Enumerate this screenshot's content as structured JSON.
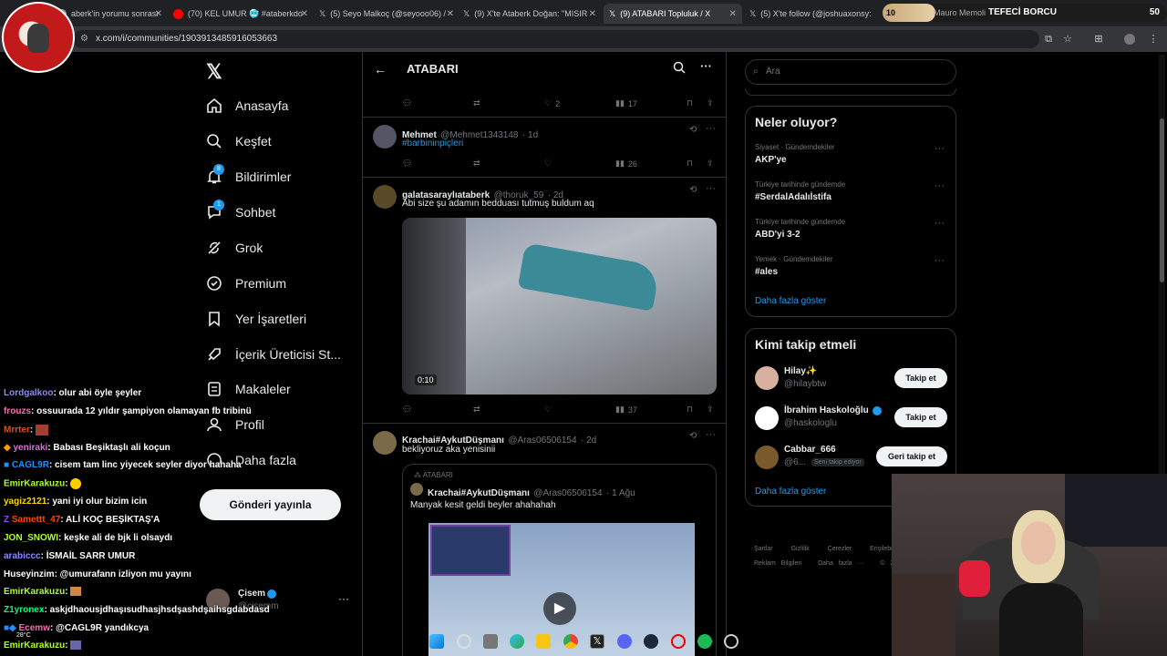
{
  "browser": {
    "tabs": [
      {
        "label": "aberk'in yorumu sonrası",
        "color": "#888"
      },
      {
        "label": "(70) KEL UMUR 🥶 #ataberkdo",
        "color": "#ff0000"
      },
      {
        "label": "(5) Seyo Malkoç (@seyooo06) /",
        "color": "#fff"
      },
      {
        "label": "(9) X'te Ataberk Doğan: \"MISIR",
        "color": "#fff"
      },
      {
        "label": "(9) ATABARI Topluluk / X",
        "color": "#fff"
      },
      {
        "label": "(5) X'te follow (@joshuaxonsy:",
        "color": "#fff"
      }
    ],
    "url": "x.com/i/communities/1903913485916053663"
  },
  "overlay": {
    "alert_count": "10",
    "alert_name": "Mauro Memoli",
    "alert_title": "TEFECİ BORCU",
    "alert_value": "50"
  },
  "nav": {
    "items": [
      {
        "label": "Anasayfa"
      },
      {
        "label": "Keşfet"
      },
      {
        "label": "Bildirimler"
      },
      {
        "label": "Sohbet"
      },
      {
        "label": "Grok"
      },
      {
        "label": "Premium"
      },
      {
        "label": "Yer İşaretleri"
      },
      {
        "label": "İçerik Üreticisi St..."
      },
      {
        "label": "Makaleler"
      },
      {
        "label": "Profil"
      },
      {
        "label": "Daha fazla"
      }
    ],
    "post_button": "Gönderi yayınla",
    "account_name": "Çisem",
    "account_handle": "@cisemm",
    "notif_badge": "8",
    "chat_badge": "1"
  },
  "feed": {
    "title": "ATABARI",
    "post1": {
      "likes": "2",
      "views": "17"
    },
    "post2": {
      "name": "Mehmet",
      "handle": "@Mehmet1343148",
      "time": "· 1d",
      "text": "#barbininpiçleri",
      "views": "26"
    },
    "post3": {
      "name": "galatasaraylıataberk",
      "handle": "@thoruk_59",
      "time": "· 2d",
      "text": "Abi size şu adamın bedduası tutmuş buldum aq",
      "duration": "0:10",
      "views": "37"
    },
    "post4": {
      "name": "Krachai#AykutDüşmanı",
      "handle": "@Aras06506154",
      "time": "· 2d",
      "text": "bekliyoruz aka yenisinii",
      "quote_community": "ATABARI",
      "quote_name": "Krachai#AykutDüşmanı",
      "quote_handle": "@Aras06506154",
      "quote_time": "· 1 Ağu",
      "quote_text": "Manyak kesit geldi beyler ahahahah"
    }
  },
  "right": {
    "search_placeholder": "Ara",
    "trends_title": "Neler oluyor?",
    "trends": [
      {
        "context": "Siyaset · Gündemdekiler",
        "name": "AKP'ye"
      },
      {
        "context": "Türkiye tarihinde gündemde",
        "name": "#SerdalAdalıİstifa"
      },
      {
        "context": "Türkiye tarihinde gündemde",
        "name": "ABD'yi 3-2"
      },
      {
        "context": "Yemek · Gündemdekiler",
        "name": "#ales"
      }
    ],
    "trends_more": "Daha fazla göster",
    "who_title": "Kimi takip etmeli",
    "who": [
      {
        "name": "Hilay✨",
        "handle": "@hilaybtw",
        "button": "Takip et"
      },
      {
        "name": "İbrahim Haskoloğlu",
        "handle": "@haskologlu",
        "button": "Takip et"
      },
      {
        "name": "Cabbar_666",
        "handle": "@6...",
        "badge": "Seni takip ediyor",
        "button": "Geri takip et"
      }
    ],
    "who_more": "Daha fazla göster",
    "footer1": [
      "Şartlar",
      "Gizlilik",
      "Çerezler",
      "Erişilebilir"
    ],
    "footer2": [
      "Reklam Bilgileri",
      "Daha fazla ···",
      "© 2026 X"
    ]
  },
  "chat": [
    {
      "user": "Lordgalkoo",
      "color": "#8a8aff",
      "text": ": olur abi öyle şeyler"
    },
    {
      "user": "frouzs",
      "color": "#ff69b4",
      "text": ": ossuurada 12 yıldır şampiyon olamayan fb tribinü"
    },
    {
      "user": "Mrrter",
      "color": "#ff4500",
      "text": ":"
    },
    {
      "user": "yeniraki",
      "color": "#da70d6",
      "text": ": Babası Beşiktaşlı ali koçun"
    },
    {
      "user": "CAGL9R",
      "color": "#1e90ff",
      "text": ": cisem tam linc yiyecek seyler diyor hahaha"
    },
    {
      "user": "EmirKarakuzu",
      "color": "#adff2f",
      "text": ":"
    },
    {
      "user": "yagiz2121",
      "color": "#ffd700",
      "text": ": yani iyi olur bizim icin"
    },
    {
      "user": "Samettt_47",
      "color": "#ff4500",
      "text": ": ALİ KOÇ BEŞİKTAŞ'A"
    },
    {
      "user": "JON_SNOWI",
      "color": "#adff2f",
      "text": ": keşke ali de bjk li olsaydı"
    },
    {
      "user": "arabiccc",
      "color": "#8a8aff",
      "text": ": İSMAİL SARR UMUR"
    },
    {
      "user": "Huseyinzim",
      "color": "#fff",
      "text": ": @umurafann izliyon mu yayını"
    },
    {
      "user": "EmirKarakuzu",
      "color": "#adff2f",
      "text": ":"
    },
    {
      "user": "Z1yronex",
      "color": "#00ff7f",
      "text": ": askjdhaousjdhaşısudhasjhsdşashdşaihsgdabdasd"
    },
    {
      "user": "Ecemw",
      "color": "#ff69b4",
      "text": ": @CAGL9R yandıkcya"
    },
    {
      "user": "EmirKarakuzu",
      "color": "#adff2f",
      "text": ":"
    }
  ],
  "taskbar": {
    "weather": "28°C"
  },
  "colors": {
    "accent": "#1d9bf0",
    "bg": "#000000",
    "border": "#2f3336"
  }
}
